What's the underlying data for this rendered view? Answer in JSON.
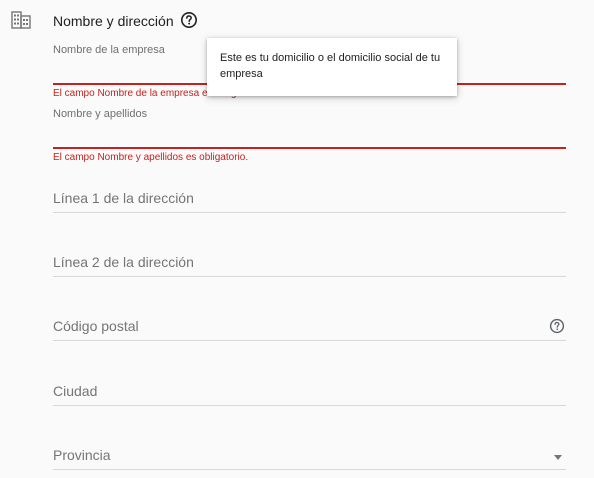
{
  "section": {
    "icon": "business-icon",
    "title": "Nombre y dirección",
    "help_icon": "help-circle-icon"
  },
  "tooltip": {
    "text": "Este es tu domicilio o el domicilio social de tu empresa"
  },
  "fields": {
    "company_name": {
      "label": "Nombre de la empresa",
      "value": "",
      "error": "El campo Nombre de la empresa es obligatorio."
    },
    "full_name": {
      "label": "Nombre y apellidos",
      "value": "",
      "error": "El campo Nombre y apellidos es obligatorio."
    },
    "address_line1": {
      "placeholder": "Línea 1 de la dirección"
    },
    "address_line2": {
      "placeholder": "Línea 2 de la dirección"
    },
    "postal_code": {
      "placeholder": "Código postal",
      "help_icon": "help-circle-icon"
    },
    "city": {
      "placeholder": "Ciudad"
    },
    "province": {
      "placeholder": "Provincia",
      "dropdown_icon": "caret-down-icon"
    }
  },
  "colors": {
    "error": "#c5221f",
    "text": "#202124",
    "muted": "#757575",
    "divider": "#d8d8d8",
    "background": "#fafafa"
  }
}
